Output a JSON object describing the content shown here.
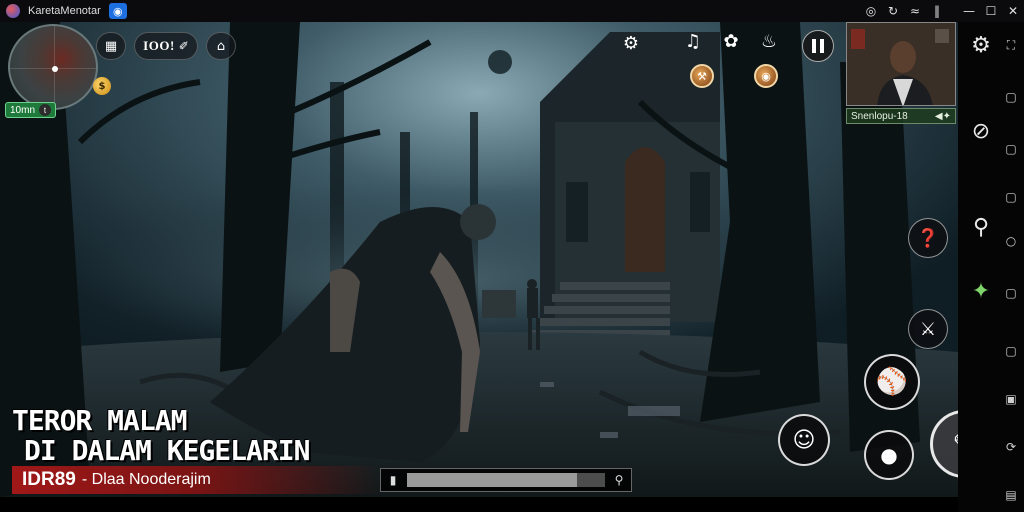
{
  "window": {
    "title": "KaretaMenotar",
    "badge_icon": "shield-icon",
    "controls": [
      "signal-icon",
      "refresh-icon",
      "wifi-icon",
      "bars-icon",
      "minimize-icon",
      "maximize-icon",
      "close-icon"
    ]
  },
  "hud": {
    "level_label": "10mn",
    "level_badge": "t",
    "pill_score": "IOO!",
    "coin_label": "$",
    "top_icons": [
      "gear-icon",
      "boots-icon",
      "flower-icon",
      "chicken-icon"
    ],
    "small_round_icons": [
      "claw-icon",
      "bag-icon"
    ],
    "camera_label": "Snenlopu-18",
    "camera_suffix": "◀✦"
  },
  "game": {
    "title_line1": "TEROR MALAM",
    "title_line2": "DI DALAM KEGELARIN",
    "code": "IDR89",
    "subtitle": "- Dlaa Nooderajim",
    "progress": 0.86
  },
  "actions": {
    "right_buttons": [
      "syringe-icon",
      "knife-icon",
      "ball-icon",
      "face-icon",
      "crouch-icon",
      "attack-icon"
    ]
  },
  "sidebar": {
    "big_icons": [
      "settings-gear-icon",
      "eraser-icon",
      "magnify-icon",
      "wand-icon"
    ],
    "small_icons": [
      "expand-icon",
      "square-icon",
      "square-icon",
      "square-icon",
      "circle-icon",
      "square-icon",
      "square-icon",
      "rotate-icon",
      "screen-icon"
    ]
  },
  "colors": {
    "accent_red": "#a01818",
    "level_green": "#1e7a3a"
  }
}
